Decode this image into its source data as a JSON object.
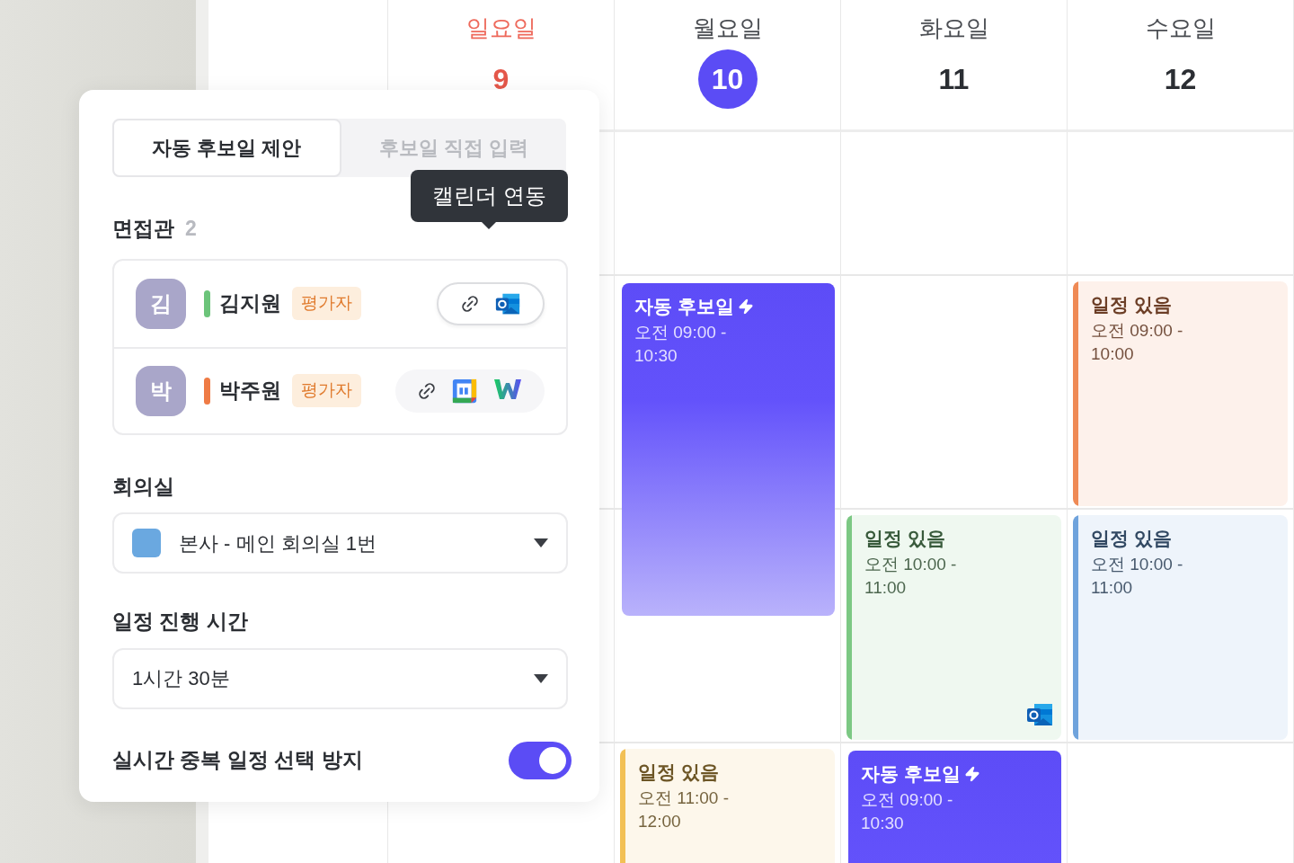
{
  "calendar": {
    "days": [
      {
        "name": "일요일",
        "date": "9",
        "holiday": true,
        "selected": false,
        "cells": [
          {
            "kind": "empty"
          },
          {
            "kind": "empty"
          },
          {
            "kind": "empty"
          },
          {
            "kind": "empty"
          }
        ]
      },
      {
        "name": "월요일",
        "date": "10",
        "holiday": false,
        "selected": true,
        "cells": [
          {
            "kind": "empty"
          },
          {
            "kind": "suggestion",
            "title": "자동 후보일",
            "time": "오전 09:00 - 10:30"
          },
          {
            "kind": "empty"
          },
          {
            "kind": "busy",
            "title": "일정 있음",
            "time": "오전 11:00 - 12:00",
            "color": "#f2c055"
          }
        ]
      },
      {
        "name": "화요일",
        "date": "11",
        "holiday": false,
        "selected": false,
        "cells": [
          {
            "kind": "empty"
          },
          {
            "kind": "empty"
          },
          {
            "kind": "busy",
            "title": "일정 있음",
            "time": "오전 10:00 - 11:00",
            "color": "#7cc884",
            "source": {
              "kind": "outlook"
            }
          },
          {
            "kind": "suggestion",
            "title": "자동 후보일",
            "time": "오전 09:00 - 10:30"
          }
        ]
      },
      {
        "name": "수요일",
        "date": "12",
        "holiday": false,
        "selected": false,
        "cells": [
          {
            "kind": "empty"
          },
          {
            "kind": "busy",
            "title": "일정 있음",
            "time": "오전 09:00 - 10:00",
            "color": "#ef8a55"
          },
          {
            "kind": "busy",
            "title": "일정 있음",
            "time": "오전 10:00 - 11:00",
            "color": "#6fa3dc"
          },
          {
            "kind": "empty"
          }
        ]
      }
    ]
  },
  "panel": {
    "tabs": [
      {
        "label": "자동 후보일 제안",
        "selected": true
      },
      {
        "label": "후보일 직접 입력",
        "selected": false
      }
    ],
    "interviewers": {
      "label": "면접관",
      "count": "2",
      "tooltip": "캘린더 연동",
      "items": [
        {
          "initial": "김",
          "name": "김지원",
          "color": "#6cc47a",
          "role": "평가자",
          "selected": true,
          "calendars": [
            {
              "kind": "link"
            },
            {
              "kind": "outlook"
            }
          ]
        },
        {
          "initial": "박",
          "name": "박주원",
          "color": "#ef7b45",
          "role": "평가자",
          "selected": false,
          "calendars": [
            {
              "kind": "link"
            },
            {
              "kind": "google"
            },
            {
              "kind": "naver"
            }
          ]
        }
      ]
    },
    "room": {
      "label": "회의실",
      "value": "본사 - 메인 회의실 1번",
      "color": "#6aa8e0"
    },
    "duration": {
      "label": "일정 진행 시간",
      "value": "1시간 30분"
    },
    "overlap": {
      "label": "실시간 중복 일정 선택 방지",
      "on": true
    }
  }
}
